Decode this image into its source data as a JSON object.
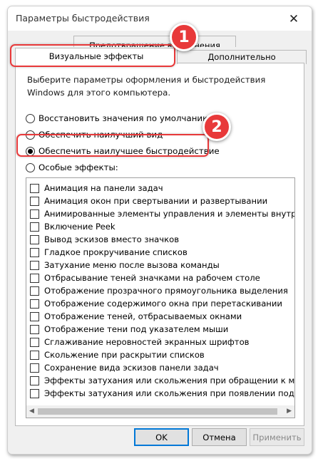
{
  "window": {
    "title": "Параметры быстродействия",
    "close_icon": "close-icon"
  },
  "tabs": {
    "back": "Предотвращение выполнения данных",
    "visual": "Визуальные эффекты",
    "advanced": "Дополнительно"
  },
  "description": "Выберите параметры оформления и быстродействия Windows для этого компьютера.",
  "options": [
    {
      "label": "Восстановить значения по умолчанию",
      "selected": false
    },
    {
      "label": "Обеспечить наилучший вид",
      "selected": false
    },
    {
      "label": "Обеспечить наилучшее быстродействие",
      "selected": true
    },
    {
      "label": "Особые эффекты:",
      "selected": false
    }
  ],
  "effects": [
    "Анимация на панели задач",
    "Анимация окон при свертывании и развертывании",
    "Анимированные элементы управления и элементы внутри окна",
    "Включение Peek",
    "Вывод эскизов вместо значков",
    "Гладкое прокручивание списков",
    "Затухание меню после вызова команды",
    "Отбрасывание теней значками на рабочем столе",
    "Отображение прозрачного прямоугольника выделения",
    "Отображение содержимого окна при перетаскивании",
    "Отображение теней, отбрасываемых окнами",
    "Отображение тени под указателем мыши",
    "Сглаживание неровностей экранных шрифтов",
    "Скольжение при раскрытии списков",
    "Сохранение вида эскизов панели задач",
    "Эффекты затухания или скольжения при обращении к меню",
    "Эффекты затухания или скольжения при появлении подсказок"
  ],
  "buttons": {
    "ok": "OK",
    "cancel": "Отмена",
    "apply": "Применить"
  },
  "annotations": {
    "badge1": "1",
    "badge2": "2",
    "accent": "#e8393a"
  }
}
